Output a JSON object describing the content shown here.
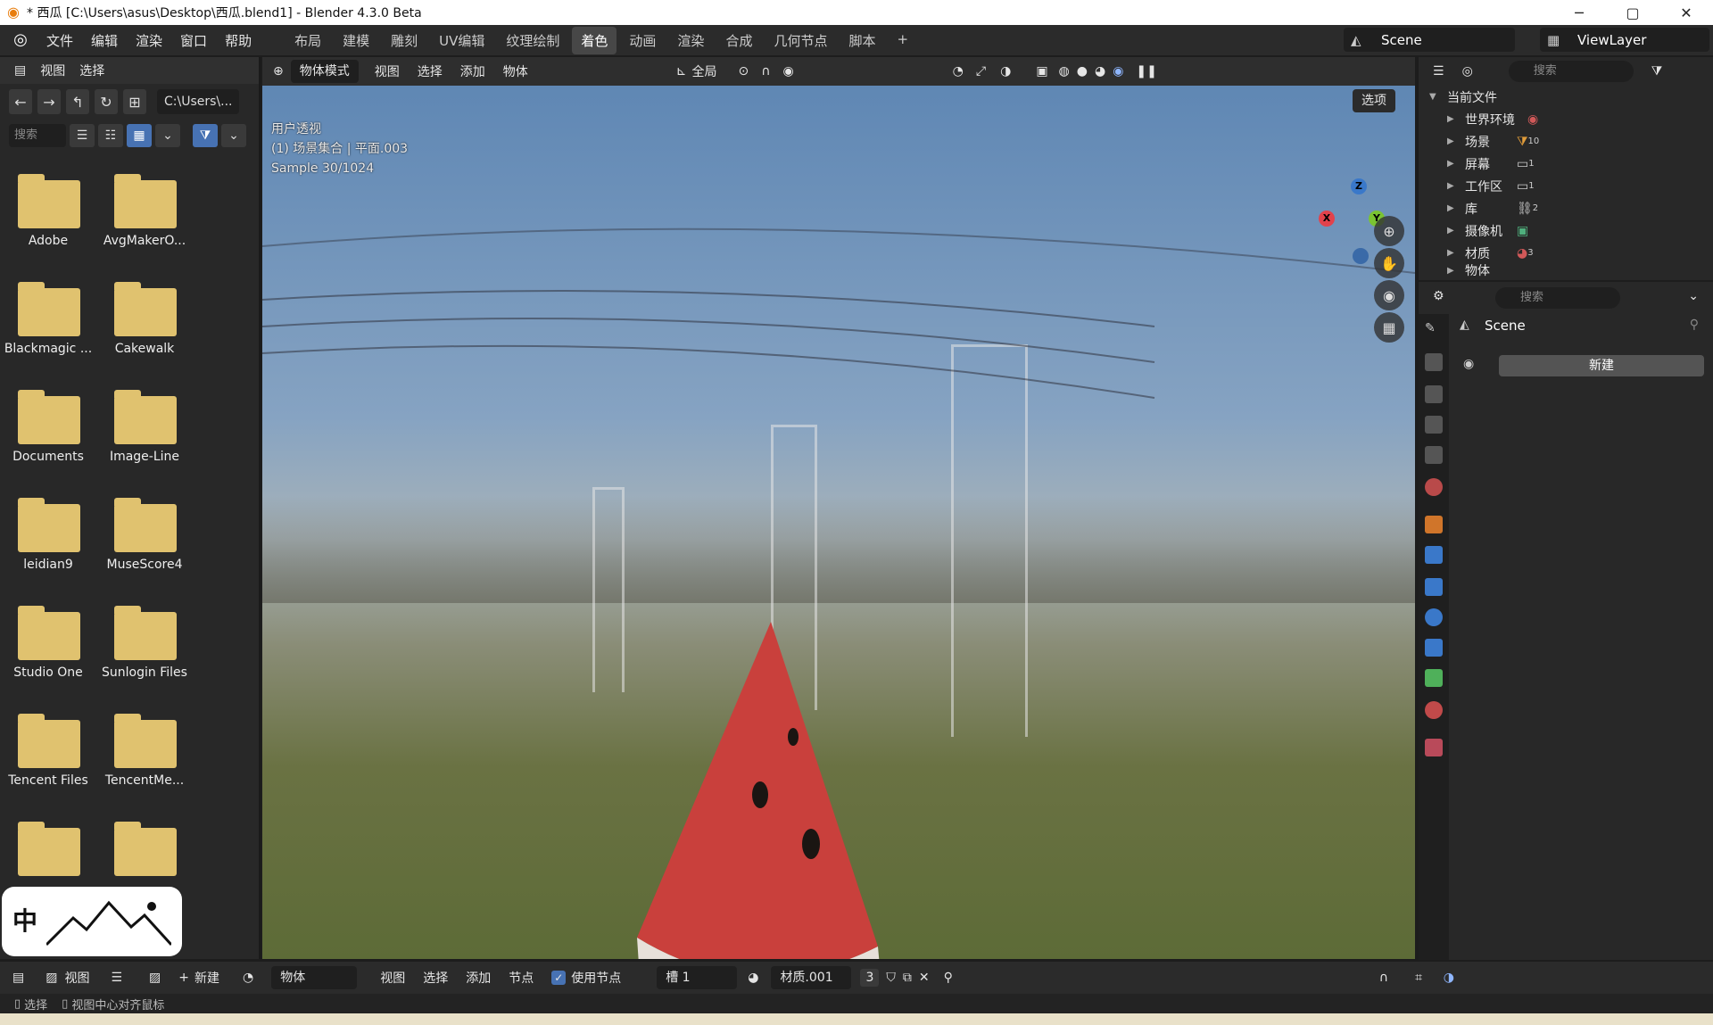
{
  "titlebar": {
    "title": "* 西瓜 [C:\\Users\\asus\\Desktop\\西瓜.blend1] - Blender 4.3.0 Beta",
    "minimize": "─",
    "maximize": "▢",
    "close": "✕"
  },
  "topbar": {
    "menus": [
      "文件",
      "编辑",
      "渲染",
      "窗口",
      "帮助"
    ],
    "workspaces": [
      "布局",
      "建模",
      "雕刻",
      "UV编辑",
      "纹理绘制",
      "着色",
      "动画",
      "渲染",
      "合成",
      "几何节点",
      "脚本",
      "+"
    ],
    "active_workspace": "着色",
    "scene": "Scene",
    "view_layer": "ViewLayer"
  },
  "filebrowser": {
    "header_menus": [
      "视图",
      "选择"
    ],
    "path": "C:\\Users\\...",
    "search_placeholder": "搜索",
    "folders": [
      "Adobe",
      "AvgMakerO...",
      "Blackmagic ...",
      "Cakewalk",
      "Documents",
      "Image-Line",
      "leidian9",
      "MuseScore4",
      "Studio One",
      "Sunlogin Files",
      "Tencent Files",
      "TencentMe...",
      "",
      ""
    ],
    "sticker_text": "中"
  },
  "viewport": {
    "mode": "物体模式",
    "menus": [
      "视图",
      "选择",
      "添加",
      "物体"
    ],
    "transform_orientation": "全局",
    "overlay_lines": [
      "用户透视",
      "(1) 场景集合 | 平面.003",
      "Sample 30/1024"
    ],
    "options_label": "选项",
    "axes": {
      "x": "X",
      "y": "Y",
      "z": "Z"
    }
  },
  "nodebar": {
    "object_label": "物体",
    "menus": [
      "视图",
      "选择",
      "添加",
      "节点"
    ],
    "use_nodes_label": "使用节点",
    "use_nodes_checked": true,
    "slot": "槽 1",
    "material": "材质.001",
    "users": "3",
    "left_view": "视图",
    "left_new": "新建"
  },
  "statusbar": {
    "items": [
      "选择",
      "视图中心对齐鼠标"
    ]
  },
  "outliner": {
    "search_placeholder": "搜索",
    "root": "当前文件",
    "rows": [
      "世界环境",
      "场景",
      "屏幕",
      "工作区",
      "库",
      "摄像机",
      "材质",
      "物体"
    ],
    "row_counts": {
      "场景": "10",
      "屏幕": "1",
      "工作区": "1",
      "库": "2",
      "材质": "3"
    }
  },
  "properties": {
    "search_placeholder": "搜索",
    "scene": "Scene",
    "new_button": "新建"
  },
  "colors": {
    "accent": "#4772b3",
    "folder": "#e0c26f",
    "melon_red": "#c9403c",
    "rind_green": "#2f8a3d",
    "x_axis": "#e2424c",
    "y_axis": "#7ac432",
    "z_axis": "#3a78c9"
  }
}
